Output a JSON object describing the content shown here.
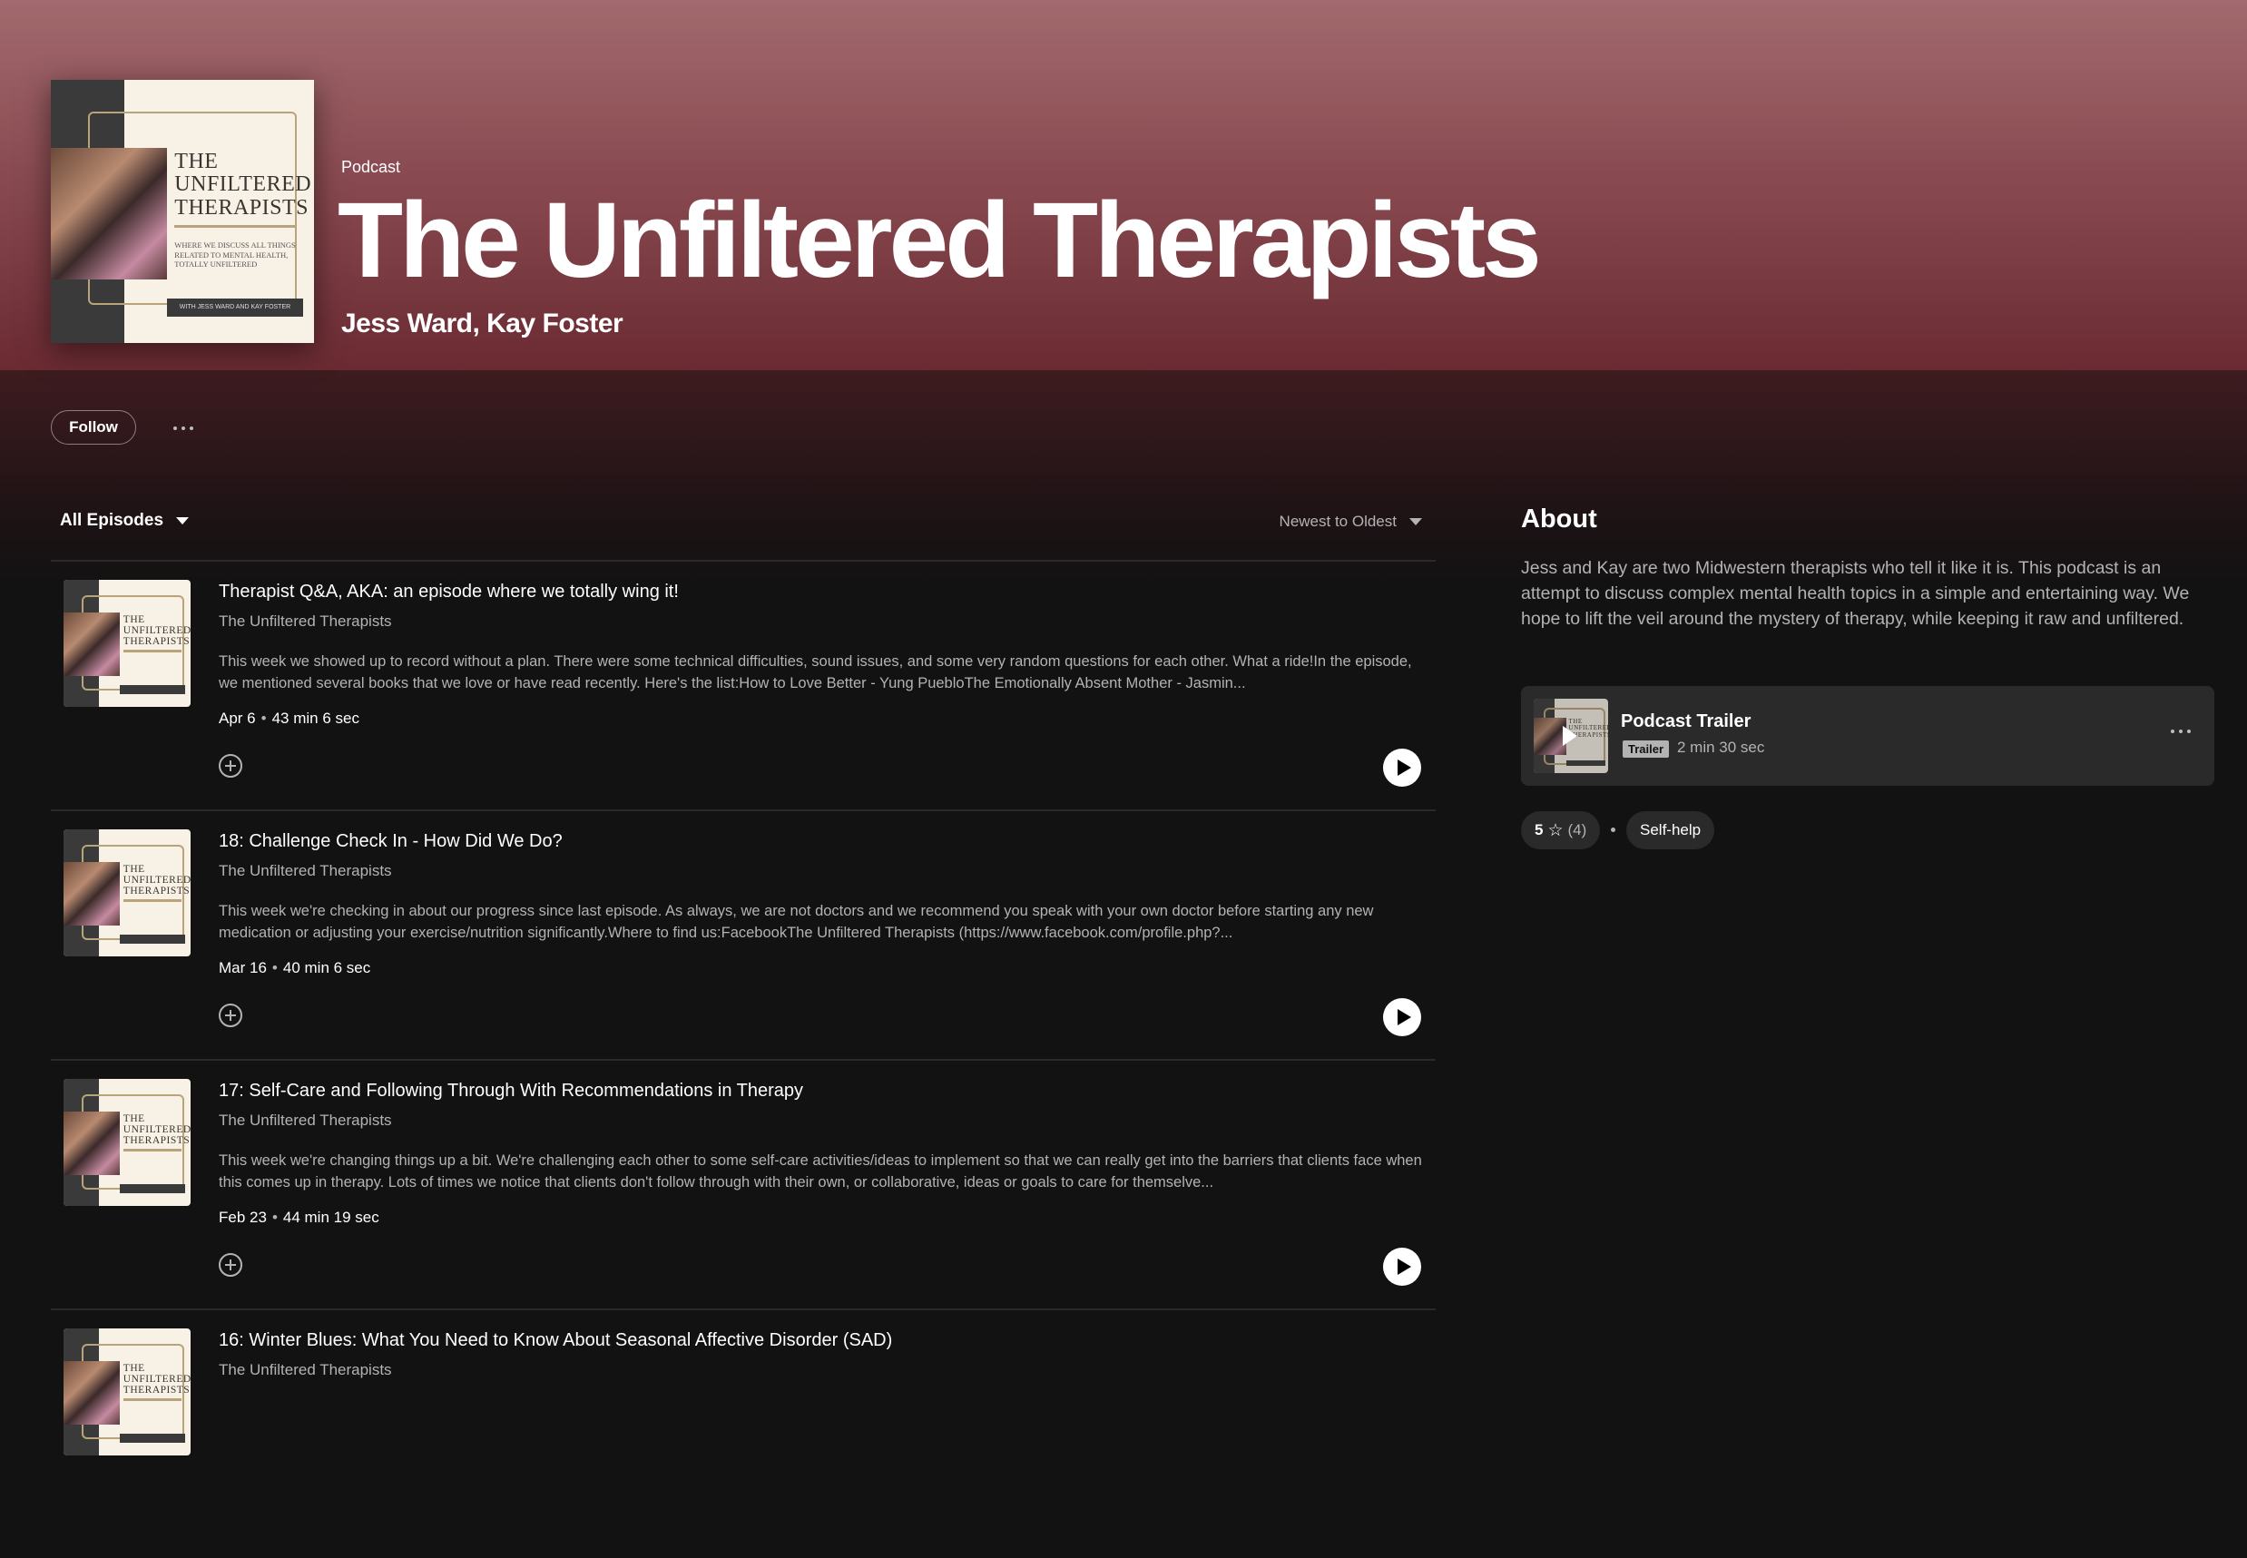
{
  "header": {
    "type_label": "Podcast",
    "title": "The Unfiltered Therapists",
    "authors": "Jess Ward, Kay Foster"
  },
  "cover_art": {
    "title_lines": [
      "THE",
      "UNFILTERED",
      "THERAPISTS"
    ],
    "tagline": "WHERE WE DISCUSS ALL THINGS RELATED TO MENTAL HEALTH, TOTALLY UNFILTERED",
    "hosts_line": "WITH JESS WARD AND KAY FOSTER"
  },
  "actions": {
    "follow_label": "Follow",
    "more_icon": "more-horizontal-icon"
  },
  "episodes_filter": {
    "label": "All Episodes",
    "sort_label": "Newest to Oldest"
  },
  "episodes": [
    {
      "title": "Therapist Q&A, AKA: an episode where we totally wing it!",
      "show": "The Unfiltered Therapists",
      "description": "This week we showed up to record without a plan. There were some technical difficulties, sound issues, and some very random questions for each other. What a ride!In the episode, we mentioned several books that we love or have read recently. Here's the list:How to Love Better - Yung PuebloThe Emotionally Absent Mother - Jasmin...",
      "date": "Apr 6",
      "duration": "43 min 6 sec"
    },
    {
      "title": "18: Challenge Check In - How Did We Do?",
      "show": "The Unfiltered Therapists",
      "description": "This week we're checking in about our progress since last episode. As always, we are not doctors and we recommend you speak with your own doctor before starting any new medication or adjusting your exercise/nutrition significantly.Where to find us:FacebookThe Unfiltered Therapists (https://www.facebook.com/profile.php?...",
      "date": "Mar 16",
      "duration": "40 min 6 sec"
    },
    {
      "title": "17: Self-Care and Following Through With Recommendations in Therapy",
      "show": "The Unfiltered Therapists",
      "description": "This week we're changing things up a bit. We're challenging each other to some self-care activities/ideas to implement so that we can really get into the barriers that clients face when this comes up in therapy. Lots of times we notice that clients don't follow through with their own, or collaborative, ideas or goals to care for themselve...",
      "date": "Feb 23",
      "duration": "44 min 19 sec"
    },
    {
      "title": "16: Winter Blues: What You Need to Know About Seasonal Affective Disorder (SAD)",
      "show": "The Unfiltered Therapists",
      "description": "",
      "date": "",
      "duration": ""
    }
  ],
  "about": {
    "heading": "About",
    "text": "Jess and Kay are two Midwestern therapists who tell it like it is. This podcast is an attempt to discuss complex mental health topics in a simple and entertaining way. We hope to lift the veil around the mystery of therapy, while keeping it raw and unfiltered."
  },
  "trailer": {
    "title": "Podcast Trailer",
    "badge": "Trailer",
    "duration": "2 min 30 sec"
  },
  "rating": {
    "value": "5",
    "star_icon": "star-outline-icon",
    "count": "(4)"
  },
  "genre": "Self-help",
  "colors": {
    "hero_top": "#a26a6e",
    "hero_bottom": "#6b2a32",
    "background": "#121212",
    "muted_text": "#b3b3b3"
  }
}
